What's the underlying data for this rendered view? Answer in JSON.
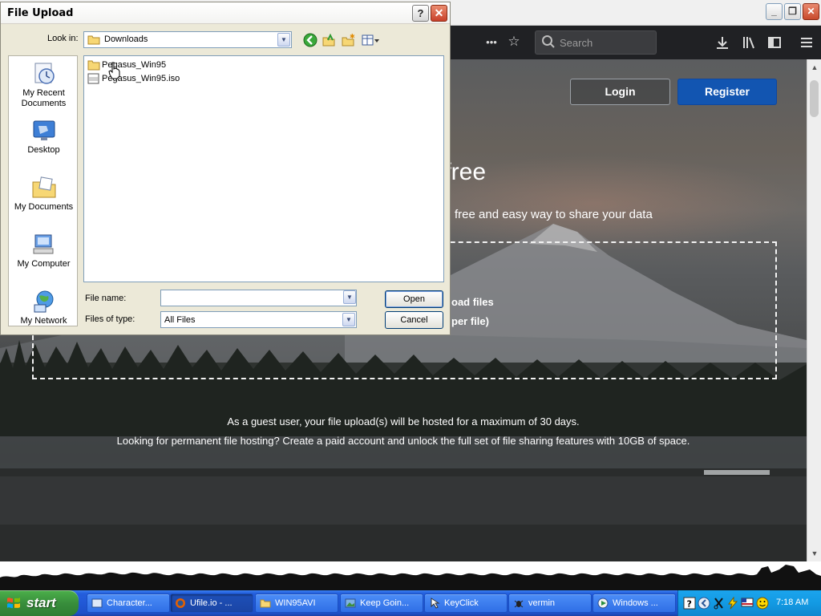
{
  "browser": {
    "toolbar": {
      "more_label": "•••",
      "search_placeholder": "Search"
    },
    "page": {
      "login_label": "Login",
      "register_label": "Register",
      "hero_title_fragment": "r free",
      "hero_subtitle_fragment": "free and easy way to share your data",
      "dropzone_line1_fragment": "oad files",
      "dropzone_line2_fragment": "per file)",
      "guest_note": "As a guest user, your file upload(s) will be hosted for a maximum of 30 days.",
      "paid_note": "Looking for permanent file hosting? Create a paid account and unlock the full set of file sharing features with 10GB of space."
    }
  },
  "dialog": {
    "title": "File Upload",
    "help_label": "?",
    "close_label": "✕",
    "look_in_label": "Look in:",
    "look_in_value": "Downloads",
    "places": [
      {
        "label": "My Recent Documents"
      },
      {
        "label": "Desktop"
      },
      {
        "label": "My Documents"
      },
      {
        "label": "My Computer"
      },
      {
        "label": "My Network"
      }
    ],
    "files": [
      {
        "name": "Pegasus_Win95",
        "kind": "folder"
      },
      {
        "name": "Pegasus_Win95.iso",
        "kind": "iso"
      }
    ],
    "file_name_label": "File name:",
    "file_name_value": "",
    "files_of_type_label": "Files of type:",
    "files_of_type_value": "All Files",
    "open_label": "Open",
    "cancel_label": "Cancel"
  },
  "taskbar": {
    "start_label": "start",
    "tasks": [
      {
        "label": "Character..."
      },
      {
        "label": "Ufile.io - ..."
      },
      {
        "label": "WIN95AVI"
      },
      {
        "label": "Keep Goin..."
      },
      {
        "label": "KeyClick"
      },
      {
        "label": "vermin"
      },
      {
        "label": "Windows ..."
      }
    ],
    "clock": "7:18 AM"
  },
  "colors": {
    "taskbar_blue": "#245edc",
    "start_green": "#388e3c",
    "register_blue": "#1255b1",
    "dialog_face": "#ece9d8"
  }
}
